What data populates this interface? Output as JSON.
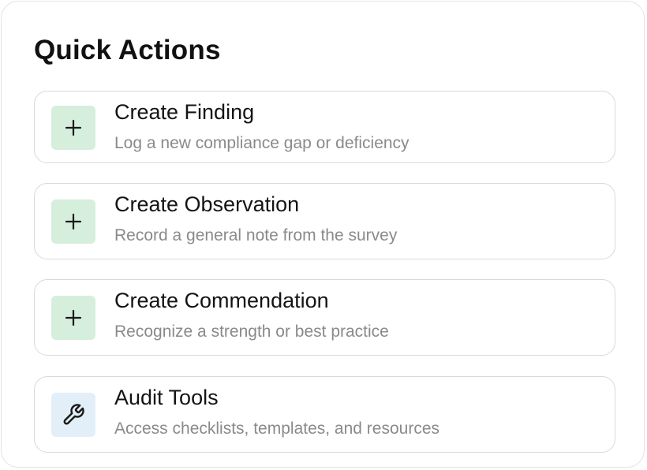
{
  "panel": {
    "title": "Quick Actions"
  },
  "actions": [
    {
      "title": "Create Finding",
      "description": "Log a new compliance gap or deficiency",
      "icon": "plus-icon",
      "icon_bg": "#d6eedc"
    },
    {
      "title": "Create Observation",
      "description": "Record a general note from the survey",
      "icon": "plus-icon",
      "icon_bg": "#d6eedc"
    },
    {
      "title": "Create Commendation",
      "description": "Recognize a strength or best practice",
      "icon": "plus-icon",
      "icon_bg": "#d6eedc"
    },
    {
      "title": "Audit Tools",
      "description": "Access checklists, templates, and resources",
      "icon": "wrench-icon",
      "icon_bg": "#e2eff8"
    }
  ]
}
